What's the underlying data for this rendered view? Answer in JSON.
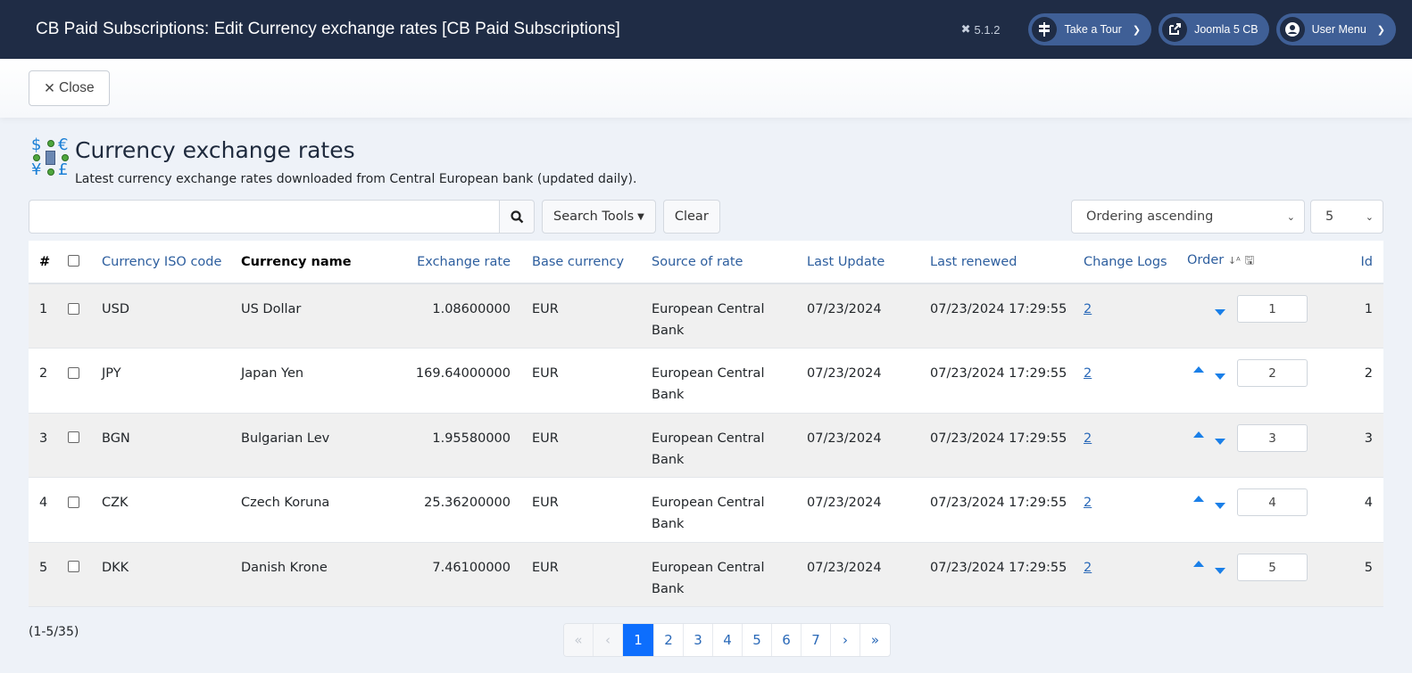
{
  "header": {
    "title": "CB Paid Subscriptions: Edit Currency exchange rates [CB Paid Subscriptions]",
    "version": "5.1.2",
    "buttons": [
      {
        "label": "Take a Tour",
        "icon": "signpost-icon"
      },
      {
        "label": "Joomla 5 CB",
        "icon": "external-link-icon"
      },
      {
        "label": "User Menu",
        "icon": "user-circle-icon"
      }
    ]
  },
  "toolbar": {
    "close_label": "Close"
  },
  "page": {
    "title": "Currency exchange rates",
    "description": "Latest currency exchange rates downloaded from Central European bank (updated daily)."
  },
  "filters": {
    "search_value": "",
    "search_placeholder": "",
    "search_tools_label": "Search Tools",
    "clear_label": "Clear",
    "ordering_selected": "Ordering ascending",
    "limit_selected": "5"
  },
  "table": {
    "columns": {
      "num": "#",
      "iso": "Currency ISO code",
      "name": "Currency name",
      "rate": "Exchange rate",
      "base": "Base currency",
      "source": "Source of rate",
      "last_update": "Last Update",
      "last_renewed": "Last renewed",
      "logs": "Change Logs",
      "order": "Order",
      "id": "Id"
    },
    "rows": [
      {
        "num": "1",
        "iso": "USD",
        "name": "US Dollar",
        "rate": "1.08600000",
        "base": "EUR",
        "source": "European Central Bank",
        "last_update": "07/23/2024",
        "last_renewed": "07/23/2024 17:29:55",
        "logs": "2",
        "order": "1",
        "id": "1",
        "up": false,
        "down": true
      },
      {
        "num": "2",
        "iso": "JPY",
        "name": "Japan Yen",
        "rate": "169.64000000",
        "base": "EUR",
        "source": "European Central Bank",
        "last_update": "07/23/2024",
        "last_renewed": "07/23/2024 17:29:55",
        "logs": "2",
        "order": "2",
        "id": "2",
        "up": true,
        "down": true
      },
      {
        "num": "3",
        "iso": "BGN",
        "name": "Bulgarian Lev",
        "rate": "1.95580000",
        "base": "EUR",
        "source": "European Central Bank",
        "last_update": "07/23/2024",
        "last_renewed": "07/23/2024 17:29:55",
        "logs": "2",
        "order": "3",
        "id": "3",
        "up": true,
        "down": true
      },
      {
        "num": "4",
        "iso": "CZK",
        "name": "Czech Koruna",
        "rate": "25.36200000",
        "base": "EUR",
        "source": "European Central Bank",
        "last_update": "07/23/2024",
        "last_renewed": "07/23/2024 17:29:55",
        "logs": "2",
        "order": "4",
        "id": "4",
        "up": true,
        "down": true
      },
      {
        "num": "5",
        "iso": "DKK",
        "name": "Danish Krone",
        "rate": "7.46100000",
        "base": "EUR",
        "source": "European Central Bank",
        "last_update": "07/23/2024",
        "last_renewed": "07/23/2024 17:29:55",
        "logs": "2",
        "order": "5",
        "id": "5",
        "up": true,
        "down": true
      }
    ]
  },
  "footer": {
    "count": "(1-5/35)",
    "pagination": {
      "first": "«",
      "prev": "‹",
      "next": "›",
      "last": "»",
      "pages": [
        "1",
        "2",
        "3",
        "4",
        "5",
        "6",
        "7"
      ],
      "current": "1"
    }
  }
}
